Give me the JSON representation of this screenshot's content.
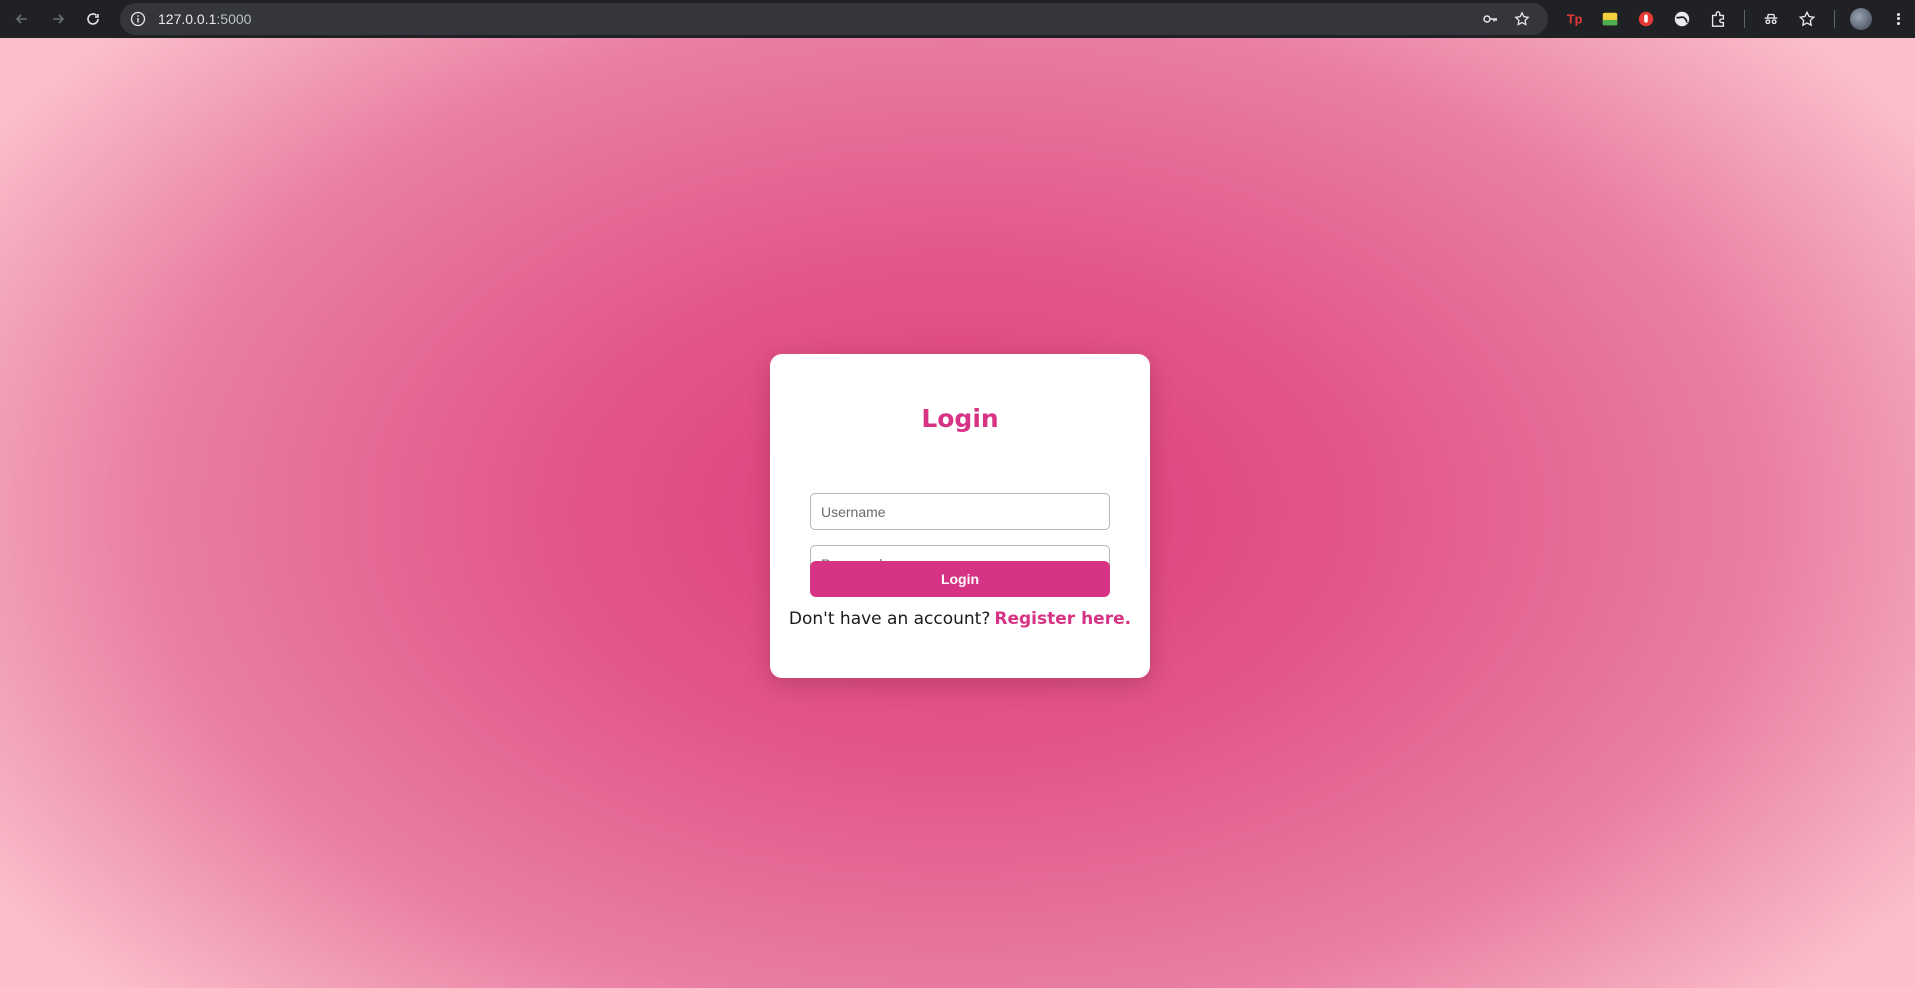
{
  "browser": {
    "url_host": "127.0.0.1",
    "url_port": ":5000"
  },
  "login": {
    "title": "Login",
    "username_placeholder": "Username",
    "password_placeholder": "Password",
    "button_label": "Login",
    "register_prompt": "Don't have an account?",
    "register_link": "Register here."
  },
  "colors": {
    "accent": "#d63384",
    "background_center": "#e03b7b",
    "background_edge": "#fbbfcb"
  }
}
